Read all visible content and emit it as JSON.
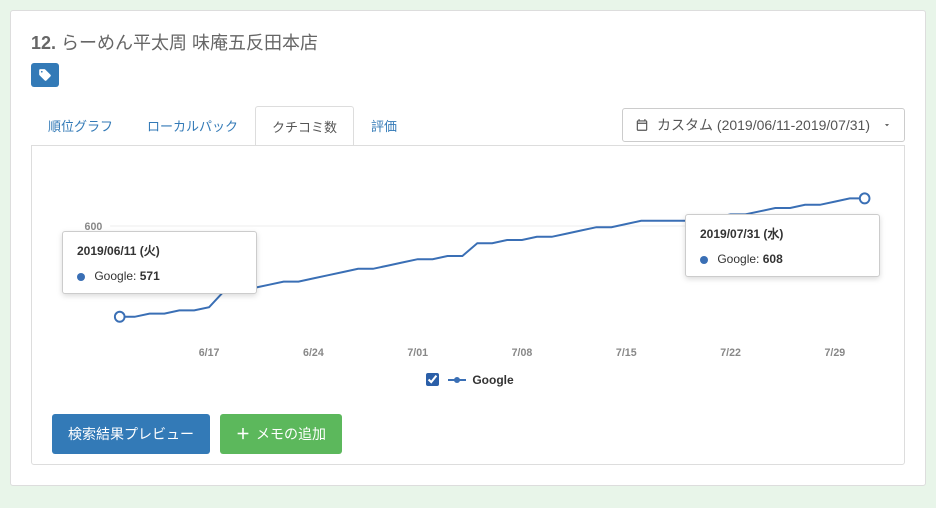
{
  "header": {
    "rank": "12.",
    "title": "らーめん平太周 味庵五反田本店"
  },
  "tabs": [
    {
      "label": "順位グラフ",
      "active": false
    },
    {
      "label": "ローカルパック",
      "active": false
    },
    {
      "label": "クチコミ数",
      "active": true
    },
    {
      "label": "評価",
      "active": false
    }
  ],
  "range": {
    "label": "カスタム (2019/06/11-2019/07/31)"
  },
  "tooltip_left": {
    "title": "2019/06/11 (火)",
    "series": "Google:",
    "value": "571"
  },
  "tooltip_right": {
    "title": "2019/07/31 (水)",
    "series": "Google:",
    "value": "608"
  },
  "legend": {
    "label": "Google"
  },
  "buttons": {
    "preview": "検索結果プレビュー",
    "add_memo": "メモの追加"
  },
  "y_axis_tick": "600",
  "x_ticks": [
    "6/17",
    "6/24",
    "7/01",
    "7/08",
    "7/15",
    "7/22",
    "7/29"
  ],
  "chart_data": {
    "type": "line",
    "title": "クチコミ数",
    "xlabel": "",
    "ylabel": "",
    "ylim": [
      565,
      615
    ],
    "series": [
      {
        "name": "Google",
        "x": [
          "6/11",
          "6/12",
          "6/13",
          "6/14",
          "6/15",
          "6/16",
          "6/17",
          "6/18",
          "6/19",
          "6/20",
          "6/21",
          "6/22",
          "6/23",
          "6/24",
          "6/25",
          "6/26",
          "6/27",
          "6/28",
          "6/29",
          "6/30",
          "7/01",
          "7/02",
          "7/03",
          "7/04",
          "7/05",
          "7/06",
          "7/07",
          "7/08",
          "7/09",
          "7/10",
          "7/11",
          "7/12",
          "7/13",
          "7/14",
          "7/15",
          "7/16",
          "7/17",
          "7/18",
          "7/19",
          "7/20",
          "7/21",
          "7/22",
          "7/23",
          "7/24",
          "7/25",
          "7/26",
          "7/27",
          "7/28",
          "7/29",
          "7/30",
          "7/31"
        ],
        "values": [
          571,
          571,
          572,
          572,
          573,
          573,
          574,
          579,
          580,
          580,
          581,
          582,
          582,
          583,
          584,
          585,
          586,
          586,
          587,
          588,
          589,
          589,
          590,
          590,
          594,
          594,
          595,
          595,
          596,
          596,
          597,
          598,
          599,
          599,
          600,
          601,
          601,
          601,
          601,
          601,
          602,
          603,
          603,
          604,
          605,
          605,
          606,
          606,
          607,
          608,
          608
        ]
      }
    ],
    "x_ticks_shown": [
      "6/17",
      "6/24",
      "7/01",
      "7/08",
      "7/15",
      "7/22",
      "7/29"
    ]
  }
}
